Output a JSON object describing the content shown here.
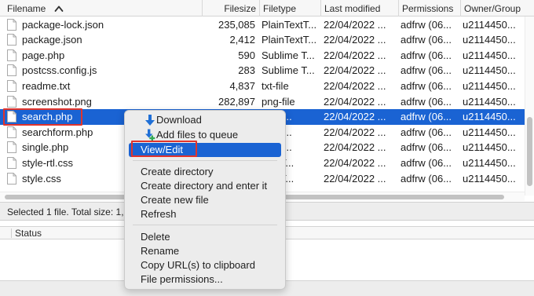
{
  "columns": {
    "filename": "Filename",
    "filesize": "Filesize",
    "filetype": "Filetype",
    "last_modified": "Last modified",
    "permissions": "Permissions",
    "owner_group": "Owner/Group"
  },
  "files": [
    {
      "name": "package-lock.json",
      "size": "235,085",
      "type": "PlainTextT...",
      "modified": "22/04/2022 ...",
      "permissions": "adfrw (06...",
      "owner": "u2114450..."
    },
    {
      "name": "package.json",
      "size": "2,412",
      "type": "PlainTextT...",
      "modified": "22/04/2022 ...",
      "permissions": "adfrw (06...",
      "owner": "u2114450..."
    },
    {
      "name": "page.php",
      "size": "590",
      "type": "Sublime T...",
      "modified": "22/04/2022 ...",
      "permissions": "adfrw (06...",
      "owner": "u2114450..."
    },
    {
      "name": "postcss.config.js",
      "size": "283",
      "type": "Sublime T...",
      "modified": "22/04/2022 ...",
      "permissions": "adfrw (06...",
      "owner": "u2114450..."
    },
    {
      "name": "readme.txt",
      "size": "4,837",
      "type": "txt-file",
      "modified": "22/04/2022 ...",
      "permissions": "adfrw (06...",
      "owner": "u2114450..."
    },
    {
      "name": "screenshot.png",
      "size": "282,897",
      "type": "png-file",
      "modified": "22/04/2022 ...",
      "permissions": "adfrw (06...",
      "owner": "u2114450..."
    },
    {
      "name": "search.php",
      "size": "",
      "type": "me T...",
      "modified": "22/04/2022 ...",
      "permissions": "adfrw (06...",
      "owner": "u2114450..."
    },
    {
      "name": "searchform.php",
      "size": "",
      "type": "me T...",
      "modified": "22/04/2022 ...",
      "permissions": "adfrw (06...",
      "owner": "u2114450..."
    },
    {
      "name": "single.php",
      "size": "",
      "type": "me T...",
      "modified": "22/04/2022 ...",
      "permissions": "adfrw (06...",
      "owner": "u2114450..."
    },
    {
      "name": "style-rtl.css",
      "size": "",
      "type": "TextT...",
      "modified": "22/04/2022 ...",
      "permissions": "adfrw (06...",
      "owner": "u2114450..."
    },
    {
      "name": "style.css",
      "size": "",
      "type": "TextT...",
      "modified": "22/04/2022 ...",
      "permissions": "adfrw (06...",
      "owner": "u2114450..."
    }
  ],
  "selected_index": 6,
  "status_text": "Selected 1 file. Total size: 1,6",
  "queue": {
    "status_header": "Status"
  },
  "context_menu": {
    "download": "Download",
    "add_to_queue": "Add files to queue",
    "view_edit": "View/Edit",
    "create_directory": "Create directory",
    "create_directory_enter": "Create directory and enter it",
    "create_new_file": "Create new file",
    "refresh": "Refresh",
    "delete": "Delete",
    "rename": "Rename",
    "copy_url": "Copy URL(s) to clipboard",
    "file_permissions": "File permissions..."
  },
  "icons": {
    "sort": "sort-ascending-icon",
    "file": "file-icon",
    "download": "download-arrow-icon",
    "add_queue": "add-to-queue-icon"
  },
  "colors": {
    "selection": "#1a63d3",
    "annotation": "#e0342c",
    "download_blue": "#1f6fd6",
    "queue_green": "#34a853"
  }
}
